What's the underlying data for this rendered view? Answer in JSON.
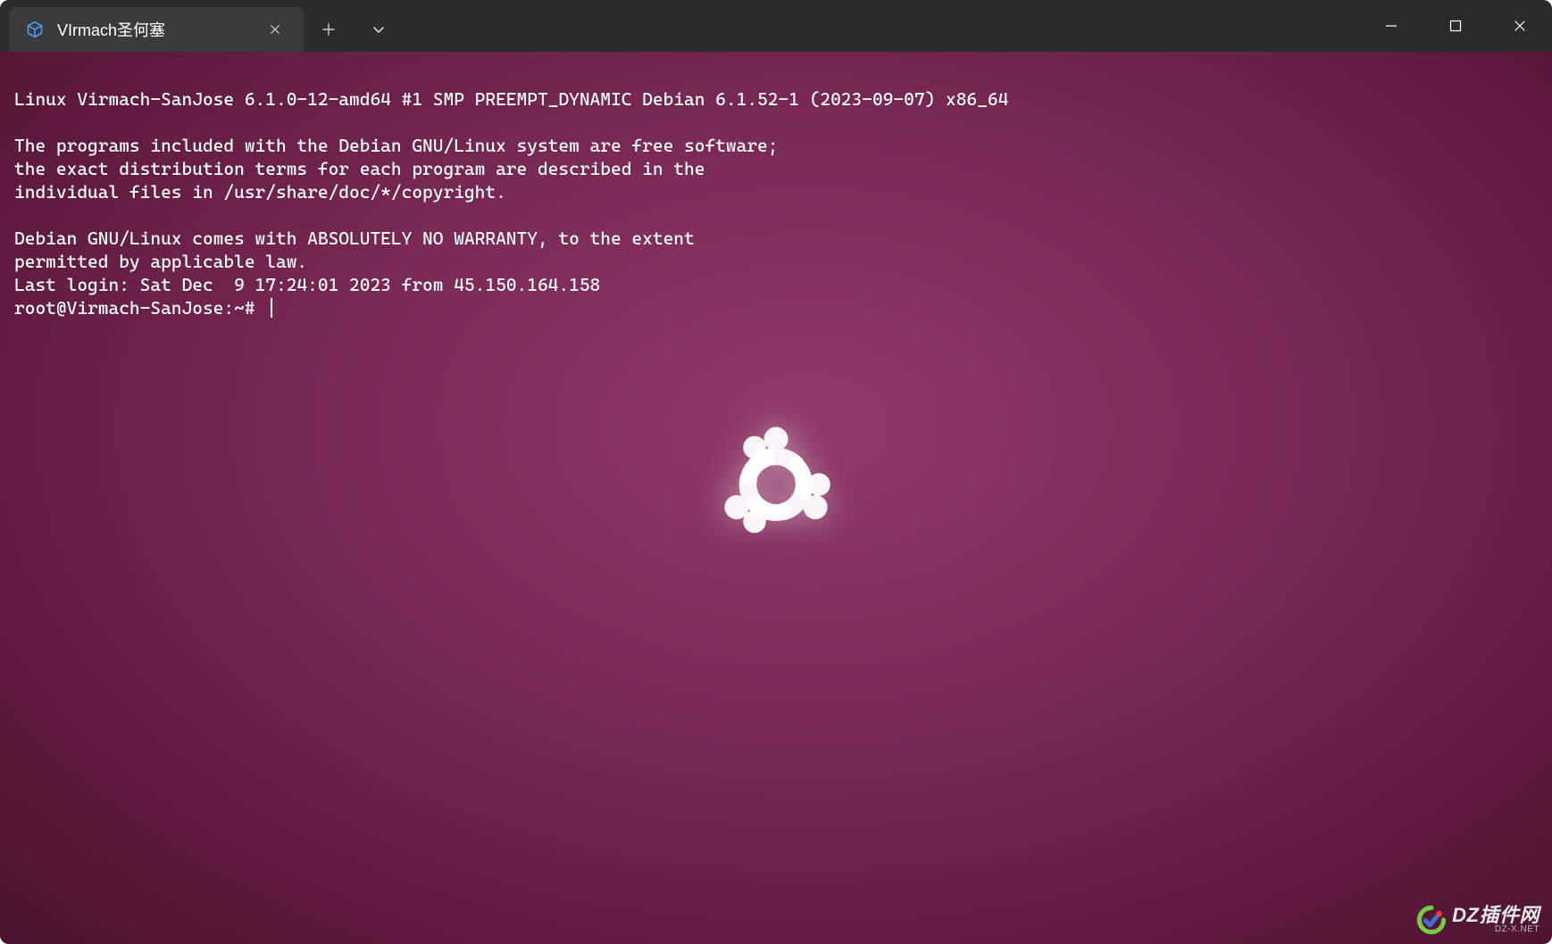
{
  "titlebar": {
    "tab_title": "VIrmach圣何塞",
    "tab_icon": "cube-icon"
  },
  "terminal": {
    "lines": [
      "Linux Virmach-SanJose 6.1.0-12-amd64 #1 SMP PREEMPT_DYNAMIC Debian 6.1.52-1 (2023-09-07) x86_64",
      "",
      "The programs included with the Debian GNU/Linux system are free software;",
      "the exact distribution terms for each program are described in the",
      "individual files in /usr/share/doc/*/copyright.",
      "",
      "Debian GNU/Linux comes with ABSOLUTELY NO WARRANTY, to the extent",
      "permitted by applicable law.",
      "Last login: Sat Dec  9 17:24:01 2023 from 45.150.164.158"
    ],
    "prompt": "root@Virmach-SanJose:~# "
  },
  "watermark": {
    "main": "DZ插件网",
    "sub": "DZ-X.NET"
  }
}
